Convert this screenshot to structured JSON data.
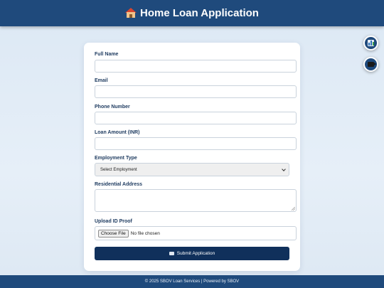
{
  "header": {
    "title": "Home Loan Application",
    "icon": "house-icon"
  },
  "side_buttons": [
    {
      "icon": "bar-chart-icon"
    },
    {
      "icon": "video-camera-icon"
    }
  ],
  "form": {
    "full_name": {
      "label": "Full Name",
      "value": "",
      "placeholder": ""
    },
    "email": {
      "label": "Email",
      "value": "",
      "placeholder": ""
    },
    "phone": {
      "label": "Phone Number",
      "value": "",
      "placeholder": ""
    },
    "loan_amount": {
      "label": "Loan Amount (INR)",
      "value": "",
      "placeholder": ""
    },
    "employment": {
      "label": "Employment Type",
      "selected": "Select Employment"
    },
    "address": {
      "label": "Residential Address",
      "value": ""
    },
    "id_proof": {
      "label": "Upload ID Proof",
      "button": "Choose File",
      "status": "No file chosen"
    },
    "submit": {
      "label": "Submit Application",
      "icon": "send-icon"
    }
  },
  "footer": {
    "text": "© 2025 SBOV Loan Services | Powered by SBOV"
  },
  "colors": {
    "primary": "#1f4a7c",
    "submit": "#10305b",
    "background": "#dce8f4"
  }
}
